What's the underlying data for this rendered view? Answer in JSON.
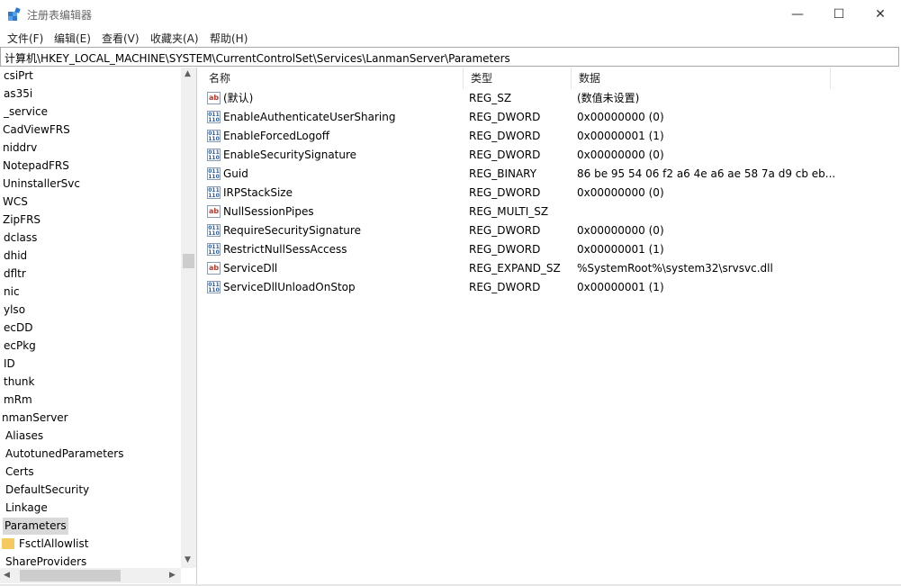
{
  "window": {
    "title": "注册表编辑器",
    "minimize": "—",
    "maximize": "☐",
    "close": "✕"
  },
  "menu": [
    "文件(F)",
    "编辑(E)",
    "查看(V)",
    "收藏夹(A)",
    "帮助(H)"
  ],
  "address": "计算机\\HKEY_LOCAL_MACHINE\\SYSTEM\\CurrentControlSet\\Services\\LanmanServer\\Parameters",
  "tree": [
    "csiPrt",
    "as35i",
    "_service",
    "CadViewFRS",
    "niddrv",
    "NotepadFRS",
    "UninstallerSvc",
    "WCS",
    "ZipFRS",
    "dclass",
    "dhid",
    "dfltr",
    "nic",
    "ylso",
    "ecDD",
    "ecPkg",
    "ID",
    "thunk",
    "mRm",
    "nmanServer",
    "Aliases",
    "AutotunedParameters",
    "Certs",
    "DefaultSecurity",
    "Linkage",
    "Parameters",
    "FsctlAllowlist",
    "ShareProviders"
  ],
  "columns": {
    "name": "名称",
    "type": "类型",
    "data": "数据"
  },
  "values": [
    {
      "icon": "ab",
      "name": "(默认)",
      "type": "REG_SZ",
      "data": "(数值未设置)"
    },
    {
      "icon": "bin",
      "name": "EnableAuthenticateUserSharing",
      "type": "REG_DWORD",
      "data": "0x00000000 (0)"
    },
    {
      "icon": "bin",
      "name": "EnableForcedLogoff",
      "type": "REG_DWORD",
      "data": "0x00000001 (1)"
    },
    {
      "icon": "bin",
      "name": "EnableSecuritySignature",
      "type": "REG_DWORD",
      "data": "0x00000000 (0)"
    },
    {
      "icon": "bin",
      "name": "Guid",
      "type": "REG_BINARY",
      "data": "86 be 95 54 06 f2 a6 4e a6 ae 58 7a d9 cb eb..."
    },
    {
      "icon": "bin",
      "name": "IRPStackSize",
      "type": "REG_DWORD",
      "data": "0x00000000 (0)"
    },
    {
      "icon": "ab",
      "name": "NullSessionPipes",
      "type": "REG_MULTI_SZ",
      "data": ""
    },
    {
      "icon": "bin",
      "name": "RequireSecuritySignature",
      "type": "REG_DWORD",
      "data": "0x00000000 (0)"
    },
    {
      "icon": "bin",
      "name": "RestrictNullSessAccess",
      "type": "REG_DWORD",
      "data": "0x00000001 (1)"
    },
    {
      "icon": "ab",
      "name": "ServiceDll",
      "type": "REG_EXPAND_SZ",
      "data": "%SystemRoot%\\system32\\srvsvc.dll"
    },
    {
      "icon": "bin",
      "name": "ServiceDllUnloadOnStop",
      "type": "REG_DWORD",
      "data": "0x00000001 (1)"
    }
  ],
  "icons": {
    "ab": "string-value-icon",
    "bin": "binary-value-icon"
  }
}
